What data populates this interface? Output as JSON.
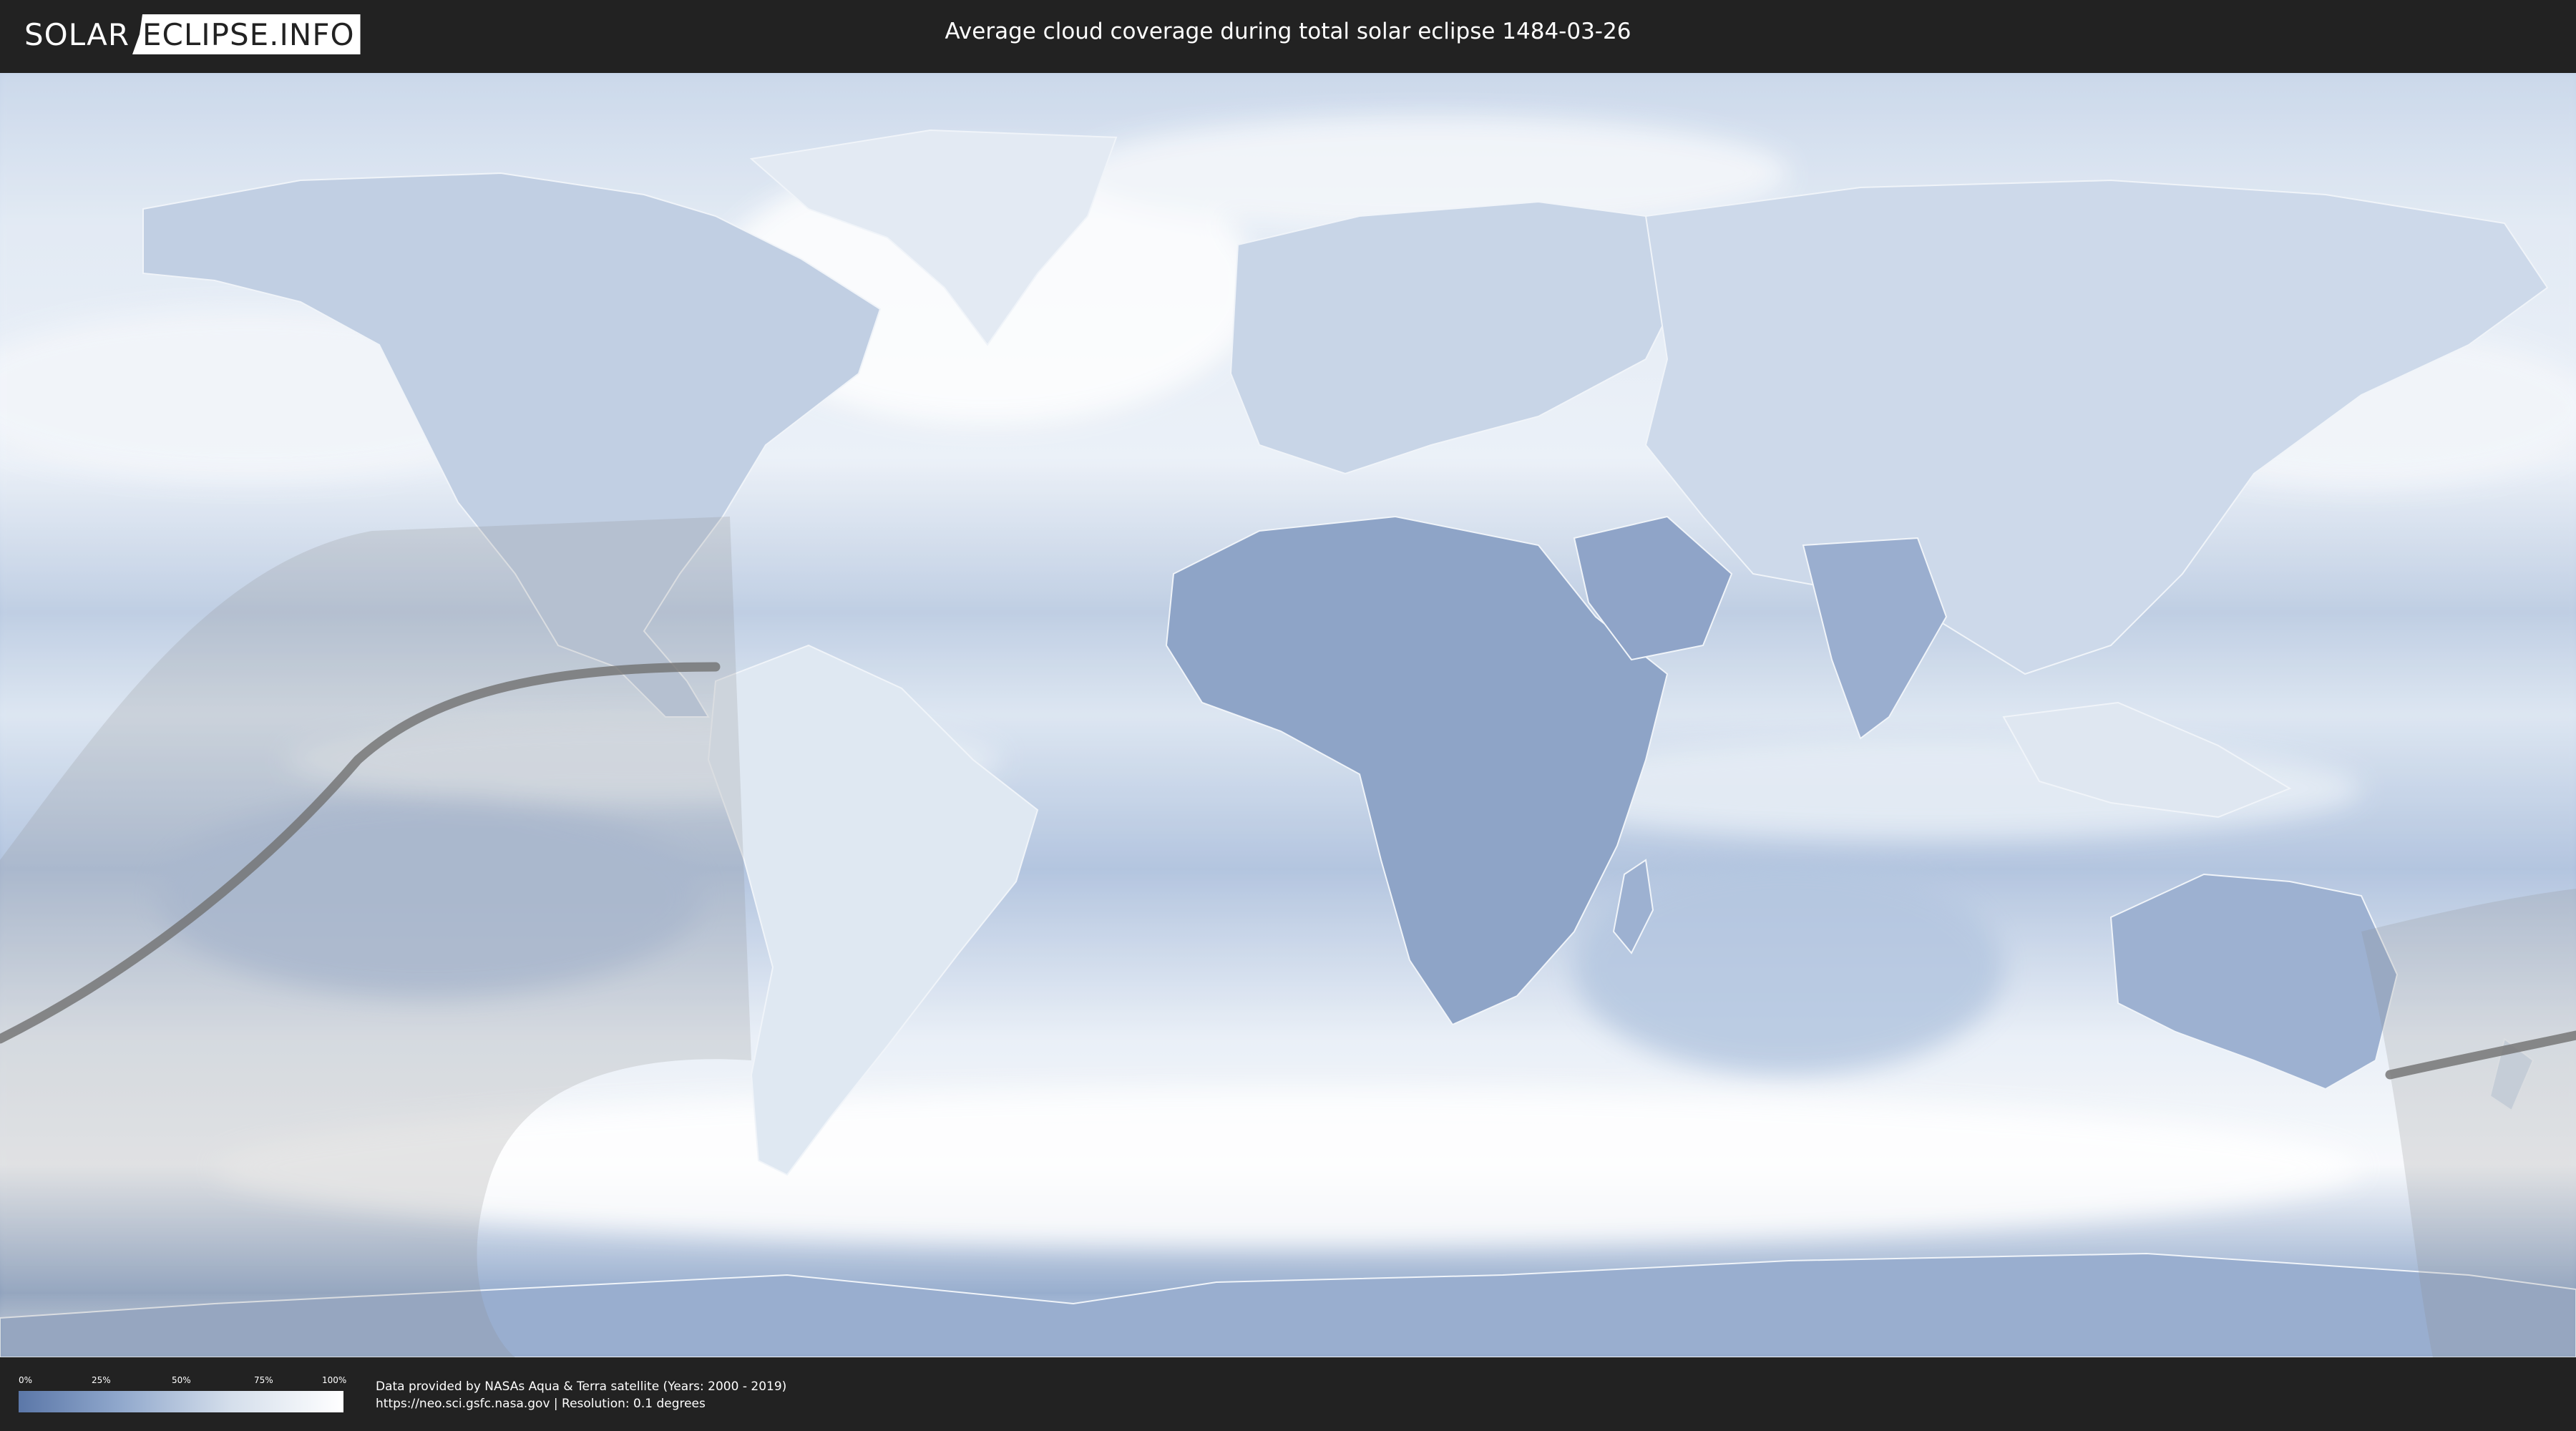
{
  "header": {
    "logo_left": "SOLAR",
    "logo_right": "ECLIPSE.INFO",
    "title": "Average cloud coverage during total solar eclipse 1484-03-26"
  },
  "legend": {
    "ticks": [
      "0%",
      "25%",
      "50%",
      "75%",
      "100%"
    ],
    "colors": {
      "low": "#5b77a8",
      "high": "#ffffff"
    }
  },
  "footer": {
    "credit_line1": "Data provided by NASAs Aqua & Terra satellite (Years: 2000 - 2019)",
    "credit_line2": "https://neo.sci.gsfc.nasa.gov | Resolution: 0.1 degrees"
  },
  "map": {
    "projection": "equirectangular world map",
    "colors": {
      "clear_sky": "#6f88b5",
      "clouds": "#ffffff",
      "eclipse_shadow": "#9a9a9a",
      "central_path": "#707070"
    }
  }
}
